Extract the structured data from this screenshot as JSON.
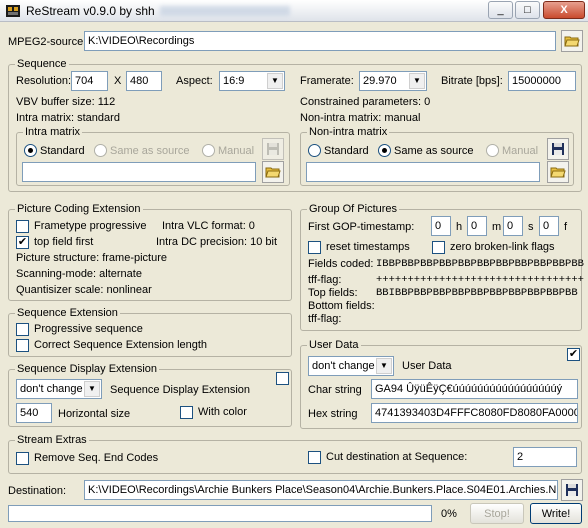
{
  "window": {
    "title": "ReStream v0.9.0 by shh",
    "min": "_",
    "max": "□",
    "close": "X"
  },
  "source": {
    "label": "MPEG2-source:",
    "value": "K:\\VIDEO\\Recordings"
  },
  "sequence": {
    "title": "Sequence",
    "resolution_label": "Resolution:",
    "width": "704",
    "x": "X",
    "height": "480",
    "aspect_label": "Aspect:",
    "aspect": "16:9",
    "framerate_label": "Framerate:",
    "framerate": "29.970",
    "bitrate_label": "Bitrate [bps]:",
    "bitrate": "15000000",
    "vbv": "VBV buffer size: 112",
    "constrained": "Constrained parameters: 0",
    "intra_matrix_info": "Intra matrix: standard",
    "nonintra_matrix_info": "Non-intra matrix: manual",
    "intra": {
      "title": "Intra matrix",
      "standard": "Standard",
      "same": "Same as source",
      "manual": "Manual"
    },
    "nonintra": {
      "title": "Non-intra matrix",
      "standard": "Standard",
      "same": "Same as source",
      "manual": "Manual"
    }
  },
  "pce": {
    "title": "Picture Coding Extension",
    "frametype": "Frametype progressive",
    "topfield": "top field first",
    "ivlc": "Intra VLC format: 0",
    "idc": "Intra DC precision: 10 bit",
    "structure": "Picture structure: frame-picture",
    "scan": "Scanning-mode: alternate",
    "quant": "Quantisizer scale: nonlinear"
  },
  "gop": {
    "title": "Group Of Pictures",
    "first_label": "First GOP-timestamp:",
    "h": "0",
    "h_unit": "h",
    "m": "0",
    "m_unit": "m",
    "s": "0",
    "s_unit": "s",
    "f": "0",
    "f_unit": "f",
    "reset": "reset timestamps",
    "zero": "zero broken-link flags",
    "fields_label": "Fields coded:",
    "fields_value": "IBBPBBPBBPBBPBBPBBPBBPBBPBBPBBPBB",
    "tff_label": "tff-flag:",
    "tff_value": "+++++++++++++++++++++++++++++++++",
    "top_label": "Top fields:",
    "top_value": "BBIBBPBBPBBPBBPBBPBBPBBPBBPBBPBB",
    "bottom_label": "Bottom fields:",
    "tff2_label": "tff-flag:"
  },
  "seqext": {
    "title": "Sequence Extension",
    "prog": "Progressive sequence",
    "correct": "Correct Sequence Extension length"
  },
  "userdata": {
    "title": "User Data",
    "select": "don't change",
    "label": "User Data",
    "char_label": "Char string",
    "char_value": "GA94 ÛÿüÊÿÇ€úúúúúúúúúúúúúúúúúý",
    "hex_label": "Hex string",
    "hex_value": "4741393403D4FFFC8080FD8080FA0000F"
  },
  "sde": {
    "title": "Sequence Display Extension",
    "select": "don't change",
    "label": "Sequence Display Extension",
    "hsize": "540",
    "hsize_label": "Horizontal size",
    "withcolor": "With color"
  },
  "extras": {
    "title": "Stream Extras",
    "remove": "Remove Seq. End Codes",
    "cut": "Cut destination at Sequence:",
    "cut_value": "2"
  },
  "destination": {
    "label": "Destination:",
    "value": "K:\\VIDEO\\Recordings\\Archie Bunkers Place\\Season04\\Archie.Bunkers.Place.S04E01.Archies.Nig"
  },
  "progress": {
    "text": "0%",
    "fraction": 0
  },
  "buttons": {
    "stop": "Stop!",
    "write": "Write!"
  }
}
